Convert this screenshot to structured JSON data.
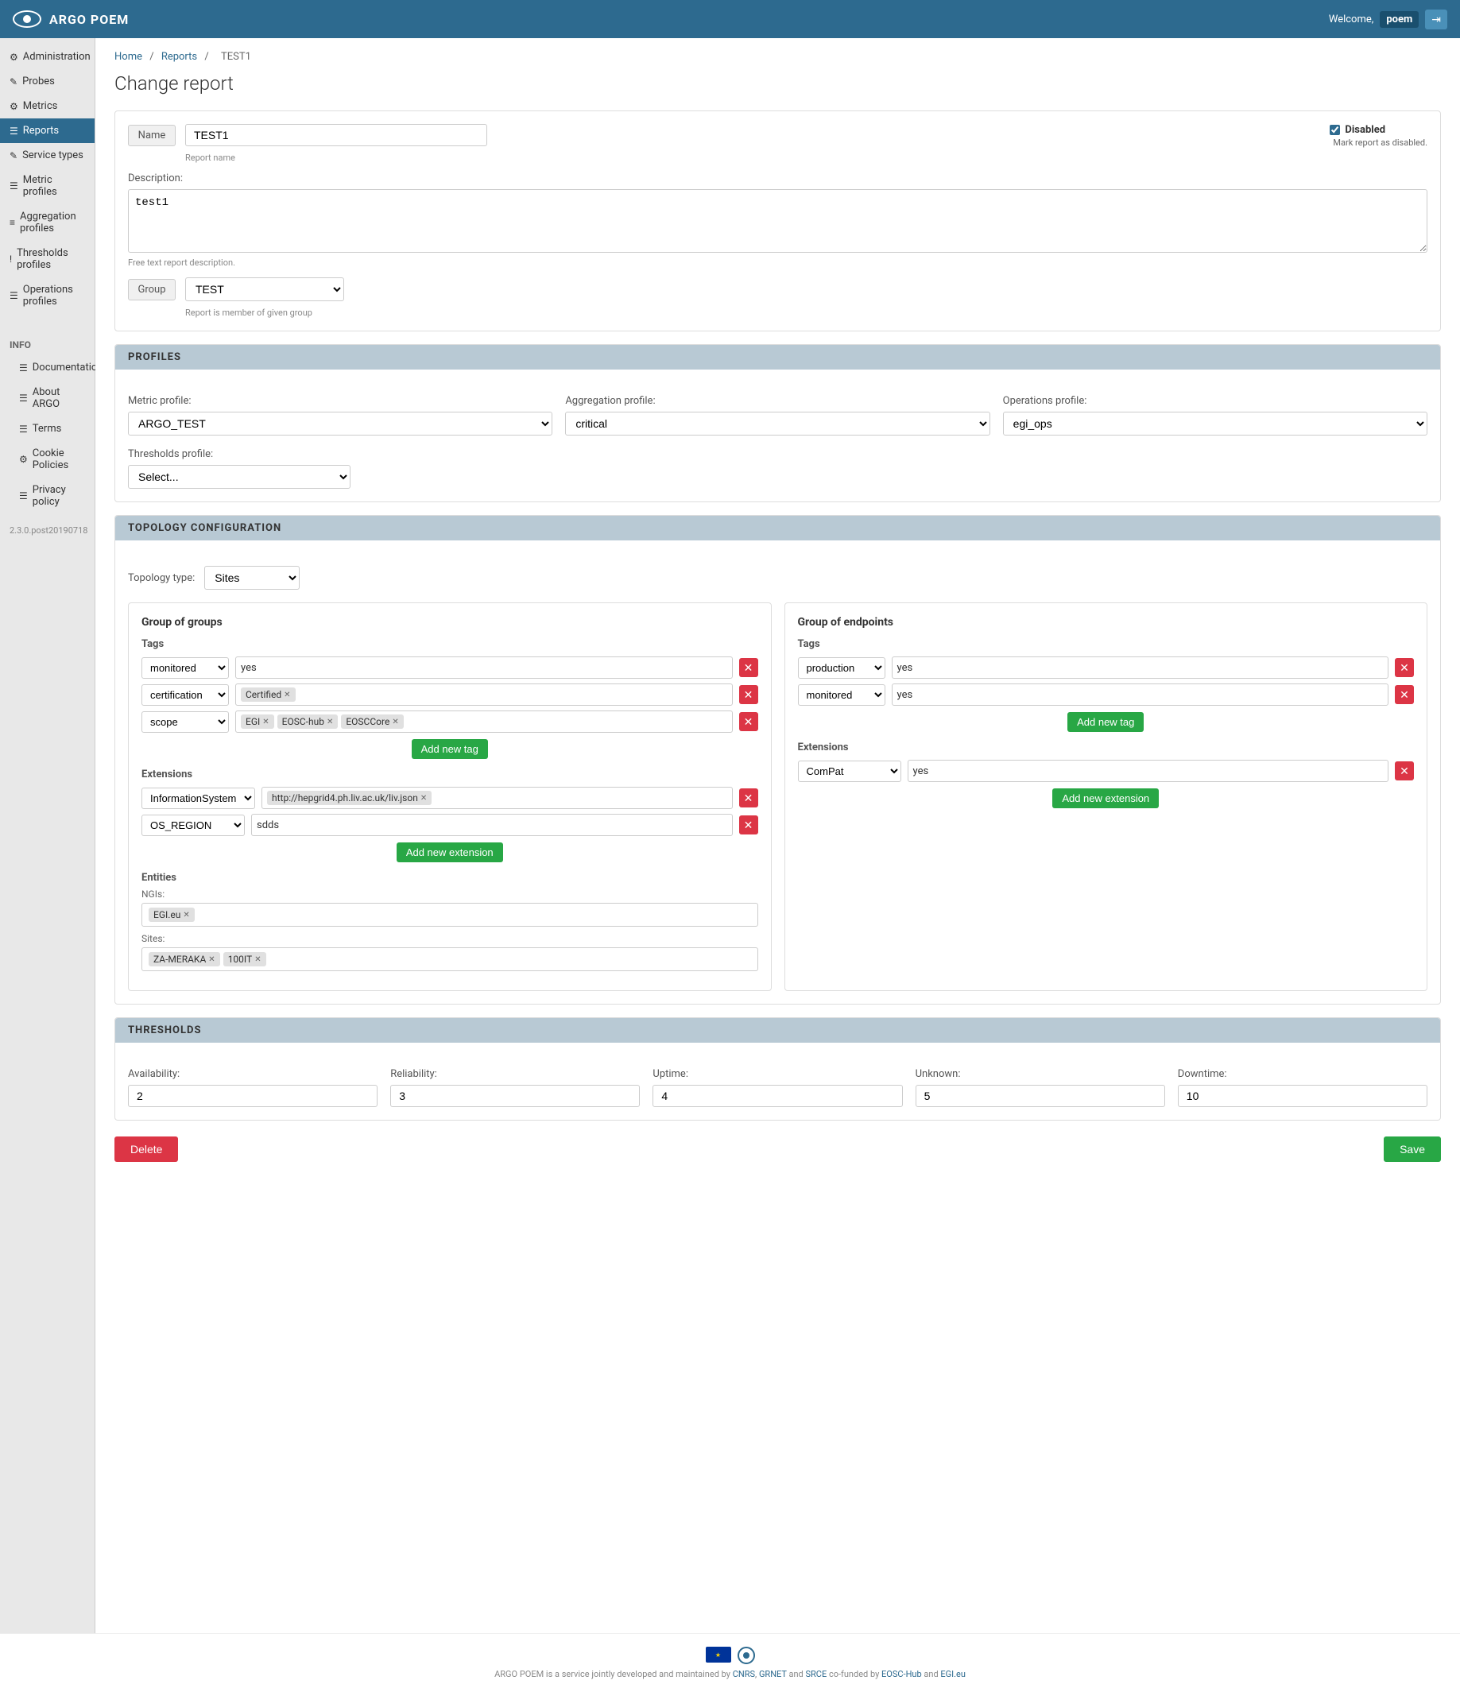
{
  "header": {
    "title": "ARGO POEM",
    "welcome": "Welcome,",
    "user": "poem"
  },
  "breadcrumb": {
    "home": "Home",
    "reports": "Reports",
    "current": "TEST1"
  },
  "page": {
    "title": "Change report"
  },
  "form": {
    "name_label": "Name",
    "name_value": "TEST1",
    "name_hint": "Report name",
    "disabled_label": "Disabled",
    "disabled_hint": "Mark report as disabled.",
    "description_label": "Description:",
    "description_value": "test1",
    "description_hint": "Free text report description.",
    "group_label": "Group",
    "group_value": "TEST",
    "group_hint": "Report is member of given group"
  },
  "profiles": {
    "section_title": "PROFILES",
    "metric_label": "Metric profile:",
    "metric_value": "ARGO_TEST",
    "aggregation_label": "Aggregation profile:",
    "aggregation_value": "critical",
    "operations_label": "Operations profile:",
    "operations_value": "egi_ops",
    "thresholds_label": "Thresholds profile:",
    "thresholds_placeholder": "Select..."
  },
  "topology": {
    "section_title": "TOPOLOGY CONFIGURATION",
    "type_label": "Topology type:",
    "type_value": "Sites",
    "group_of_groups_title": "Group of groups",
    "group_of_endpoints_title": "Group of endpoints",
    "tags_title": "Tags",
    "extensions_title": "Extensions",
    "entities_title": "Entities",
    "groups_tags": [
      {
        "key": "monitored",
        "value": "yes"
      },
      {
        "key": "certification",
        "value": "Certified"
      },
      {
        "key": "scope",
        "values": [
          "EGI",
          "EOSC-hub",
          "EOSCCore"
        ]
      }
    ],
    "groups_extensions": [
      {
        "key": "InformationSystem",
        "value": "http://hepgrid4.ph.liv.ac.uk/liv.json"
      },
      {
        "key": "OS_REGION",
        "value": "sdds"
      }
    ],
    "groups_entities_ngis": [
      "EGI.eu"
    ],
    "groups_entities_sites": [
      "ZA-MERAKA",
      "100IT"
    ],
    "endpoints_tags": [
      {
        "key": "production",
        "value": "yes"
      },
      {
        "key": "monitored",
        "value": "yes"
      }
    ],
    "endpoints_extensions": [
      {
        "key": "ComPat",
        "value": "yes"
      }
    ],
    "add_new_tag_label": "Add new tag",
    "add_new_extension_label": "Add new extension",
    "ngis_label": "NGIs:",
    "sites_label": "Sites:"
  },
  "thresholds": {
    "section_title": "THRESHOLDS",
    "availability_label": "Availability:",
    "availability_value": "2",
    "reliability_label": "Reliability:",
    "reliability_value": "3",
    "uptime_label": "Uptime:",
    "uptime_value": "4",
    "unknown_label": "Unknown:",
    "unknown_value": "5",
    "downtime_label": "Downtime:",
    "downtime_value": "10"
  },
  "actions": {
    "delete_label": "Delete",
    "save_label": "Save"
  },
  "sidebar": {
    "items": [
      {
        "label": "Administration",
        "icon": "⚙",
        "active": false
      },
      {
        "label": "Probes",
        "icon": "✎",
        "active": false
      },
      {
        "label": "Metrics",
        "icon": "⚙",
        "active": false
      },
      {
        "label": "Reports",
        "icon": "☰",
        "active": true
      },
      {
        "label": "Service types",
        "icon": "✎",
        "active": false
      },
      {
        "label": "Metric profiles",
        "icon": "☰",
        "active": false
      },
      {
        "label": "Aggregation profiles",
        "icon": "≡",
        "active": false
      },
      {
        "label": "Thresholds profiles",
        "icon": "!",
        "active": false
      },
      {
        "label": "Operations profiles",
        "icon": "☰",
        "active": false
      }
    ],
    "info_title": "INFO",
    "info_items": [
      {
        "label": "Documentation",
        "icon": "☰"
      },
      {
        "label": "About ARGO",
        "icon": "☰"
      },
      {
        "label": "Terms",
        "icon": "☰"
      },
      {
        "label": "Cookie Policies",
        "icon": "⚙"
      },
      {
        "label": "Privacy policy",
        "icon": "☰"
      }
    ],
    "version": "2.3.0.post20190718"
  },
  "footer": {
    "text": "ARGO POEM is a service jointly developed and maintained by",
    "links": [
      "CNRS",
      "GRNET",
      "SRCE"
    ],
    "text2": "co-funded by",
    "links2": [
      "EOSC-Hub",
      "EGI.eu"
    ]
  }
}
